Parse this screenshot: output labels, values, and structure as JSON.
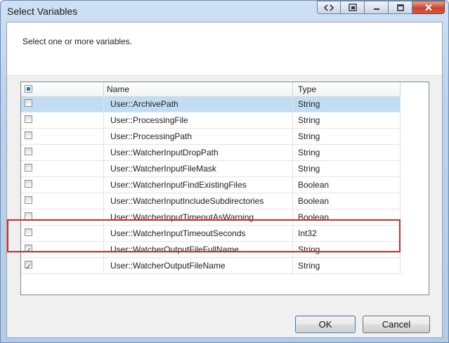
{
  "window": {
    "title": "Select Variables"
  },
  "instruction": "Select one or more variables.",
  "grid": {
    "columns": {
      "name": "Name",
      "type": "Type"
    },
    "rows": [
      {
        "name": "User::ArchivePath",
        "type": "String",
        "checked": false,
        "selected": true
      },
      {
        "name": "User::ProcessingFile",
        "type": "String",
        "checked": false
      },
      {
        "name": "User::ProcessingPath",
        "type": "String",
        "checked": false
      },
      {
        "name": "User::WatcherInputDropPath",
        "type": "String",
        "checked": false
      },
      {
        "name": "User::WatcherInputFileMask",
        "type": "String",
        "checked": false
      },
      {
        "name": "User::WatcherInputFindExistingFiles",
        "type": "Boolean",
        "checked": false
      },
      {
        "name": "User::WatcherInputIncludeSubdirectories",
        "type": "Boolean",
        "checked": false
      },
      {
        "name": "User::WatcherInputTimeoutAsWarning",
        "type": "Boolean",
        "checked": false
      },
      {
        "name": "User::WatcherInputTimeoutSeconds",
        "type": "Int32",
        "checked": false
      },
      {
        "name": "User::WatcherOutputFileFullName",
        "type": "String",
        "checked": true
      },
      {
        "name": "User::WatcherOutputFileName",
        "type": "String",
        "checked": true
      }
    ]
  },
  "buttons": {
    "ok": "OK",
    "cancel": "Cancel"
  },
  "colors": {
    "highlight": "#d52b2b",
    "selection": "#c2dcf2"
  }
}
